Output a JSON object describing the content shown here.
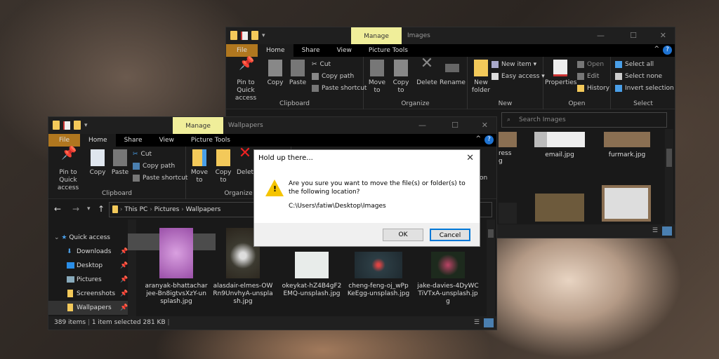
{
  "back_window": {
    "manage": "Manage",
    "title": "Images",
    "tabs": [
      "File",
      "Home",
      "Share",
      "View",
      "Picture Tools"
    ],
    "clipboard": {
      "pin": "Pin to Quick access",
      "copy": "Copy",
      "paste": "Paste",
      "cut": "Cut",
      "copy_path": "Copy path",
      "paste_shortcut": "Paste shortcut",
      "label": "Clipboard"
    },
    "organize": {
      "move": "Move to",
      "copy": "Copy to",
      "delete": "Delete",
      "rename": "Rename",
      "label": "Organize"
    },
    "new": {
      "folder": "New folder",
      "item": "New item ▾",
      "easy": "Easy access ▾",
      "label": "New"
    },
    "open": {
      "properties": "Properties",
      "open": "Open",
      "edit": "Edit",
      "history": "History",
      "label": "Open"
    },
    "select": {
      "all": "Select all",
      "none": "Select none",
      "invert": "Invert selection",
      "label": "Select"
    },
    "search_placeholder": "Search Images",
    "files": [
      "ress\ng",
      "email.jpg",
      "furmark.jpg"
    ]
  },
  "front_window": {
    "manage": "Manage",
    "title": "Wallpapers",
    "tabs": [
      "File",
      "Home",
      "Share",
      "View",
      "Picture Tools"
    ],
    "clipboard": {
      "pin": "Pin to Quick access",
      "copy": "Copy",
      "paste": "Paste",
      "cut": "Cut",
      "copy_path": "Copy path",
      "paste_shortcut": "Paste shortcut",
      "label": "Clipboard"
    },
    "organize": {
      "move": "Move to",
      "copy": "Copy to",
      "delete": "Delet",
      "label": "Organize"
    },
    "ribbon_partial": "on",
    "breadcrumb": [
      "This PC",
      "Pictures",
      "Wallpapers"
    ],
    "nav": [
      {
        "label": "Quick access"
      },
      {
        "label": "Downloads"
      },
      {
        "label": "Desktop"
      },
      {
        "label": "Pictures"
      },
      {
        "label": "Screenshots"
      },
      {
        "label": "Wallpapers"
      }
    ],
    "files": [
      "aranyak-bhattacharjee-Bn8igtvsXzY-unsplash.jpg",
      "alasdair-elmes-OWRn9UnvhyA-unsplash.jpg",
      "okeykat-hZ4B4gF2EMQ-unsplash.jpg",
      "cheng-feng-oj_wPpKeEgg-unsplash.jpg",
      "jake-davies-4DyWCTiVTxA-unsplash.jpg"
    ],
    "status": {
      "items": "389 items",
      "selected": "1 item selected",
      "size": "281 KB"
    }
  },
  "dialog": {
    "title": "Hold up there...",
    "message": "Are you sure you want to move the file(s) or folder(s) to the following location?",
    "path": "C:\\Users\\fatiw\\Desktop\\Images",
    "ok": "OK",
    "cancel": "Cancel"
  }
}
